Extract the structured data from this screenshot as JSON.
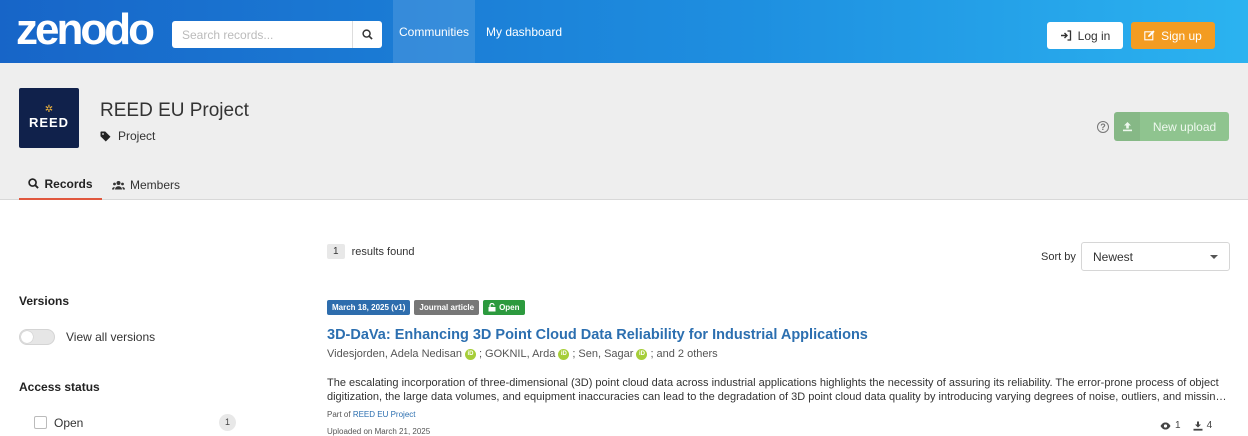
{
  "header": {
    "logo": "zenodo",
    "search_placeholder": "Search records...",
    "nav_communities": "Communities",
    "nav_dashboard": "My dashboard",
    "login_label": "Log in",
    "signup_label": "Sign up"
  },
  "community": {
    "logo_text": "REED",
    "title": "REED EU Project",
    "type": "Project",
    "new_upload_label": "New upload",
    "tabs": {
      "records": "Records",
      "members": "Members"
    }
  },
  "sidebar": {
    "versions_heading": "Versions",
    "view_all_versions": "View all versions",
    "access_heading": "Access status",
    "open_label": "Open",
    "open_count": "1"
  },
  "results": {
    "count": "1",
    "count_text": "results found",
    "sort_label": "Sort by",
    "sort_value": "Newest"
  },
  "record": {
    "badge_date": "March 18, 2025 (v1)",
    "badge_type": "Journal article",
    "badge_access": "Open",
    "title": "3D-DaVa: Enhancing 3D Point Cloud Data Reliability for Industrial Applications",
    "author1": "Videsjorden, Adela Nedisan",
    "author2": "GOKNIL, Arda",
    "author3": "Sen, Sagar",
    "author_more": "and 2 others",
    "description_line1": "The escalating incorporation of three-dimensional (3D) point cloud data across industrial applications highlights the necessity of assuring its reliability. The error-prone process of object",
    "description_line2": "digitization, the large data volumes, and equipment inaccuracies can lead to the degradation of 3D point cloud data quality by introducing varying degrees of noise, outliers, and missing values…",
    "part_of_prefix": "Part of",
    "part_of_link": "REED EU Project",
    "uploaded": "Uploaded on March 21, 2025",
    "views": "1",
    "downloads": "4"
  },
  "colors": {
    "header_start": "#1765c8",
    "header_end": "#2bb3f0",
    "signup": "#f39c22",
    "upload": "#8fc48f",
    "link": "#2c6fb0",
    "badge_date": "#2e6dad",
    "badge_open": "#2c9a3e"
  }
}
